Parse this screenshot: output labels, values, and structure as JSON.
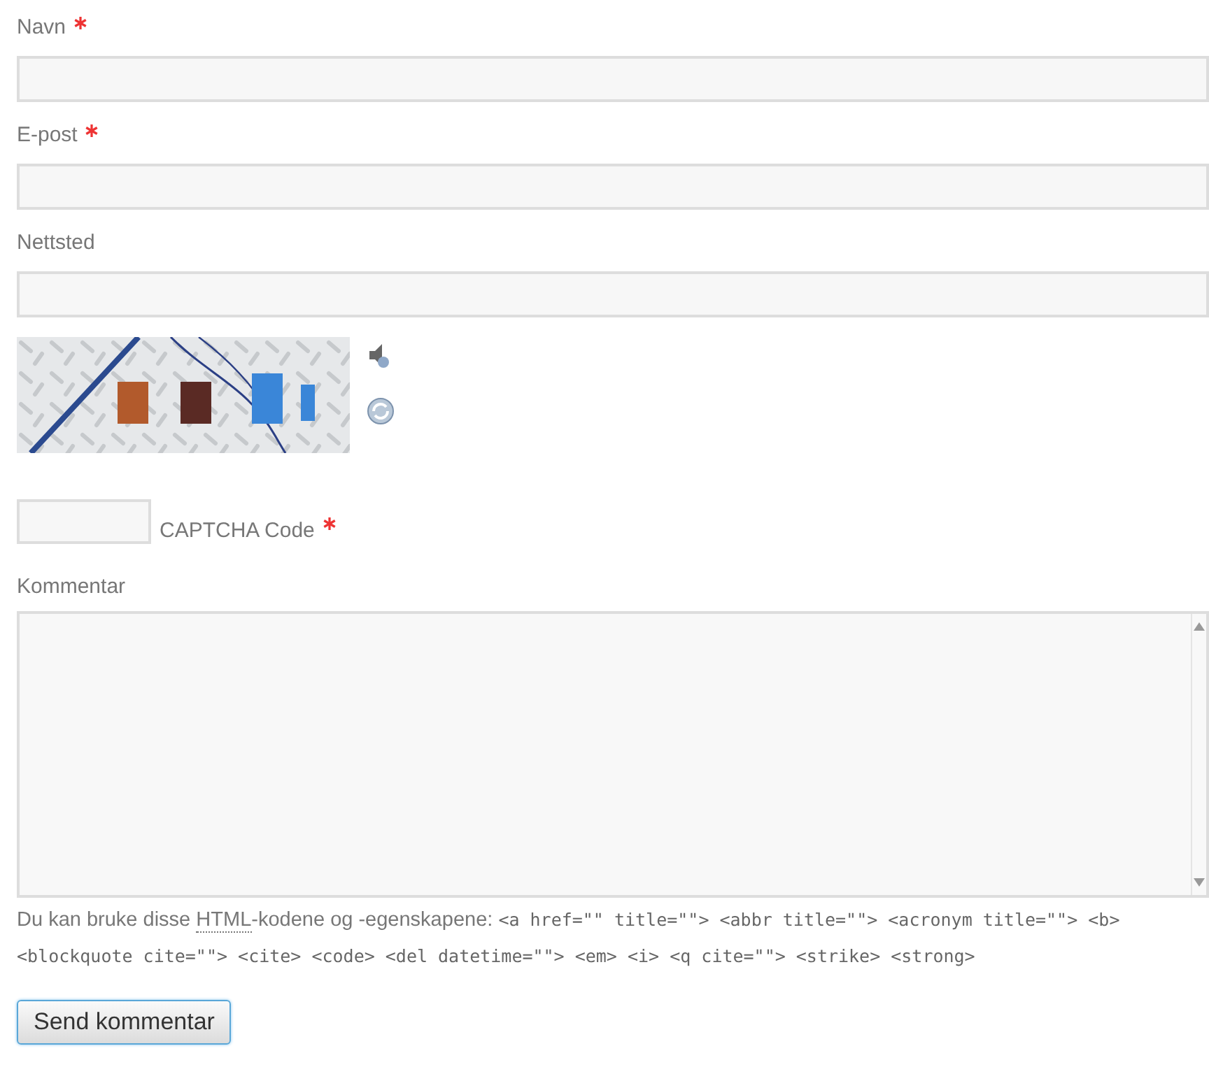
{
  "fields": [
    {
      "label": "Navn",
      "required": true,
      "kind": "text"
    },
    {
      "label": "E-post",
      "required": true,
      "kind": "text"
    },
    {
      "label": "Nettsted",
      "required": false,
      "kind": "text"
    }
  ],
  "captcha": {
    "code_label": "CAPTCHA Code",
    "required": true
  },
  "comment": {
    "label": "Kommentar"
  },
  "allowed_tags": {
    "before": "Du kan bruke disse ",
    "abbr": "HTML",
    "after": "-kodene og -egenskapene: ",
    "code": "<a href=\"\" title=\"\"> <abbr title=\"\"> <acronym title=\"\"> <b> <blockquote cite=\"\"> <cite> <code> <del datetime=\"\"> <em> <i> <q cite=\"\"> <strike> <strong>"
  },
  "submit": {
    "label": "Send kommentar"
  }
}
